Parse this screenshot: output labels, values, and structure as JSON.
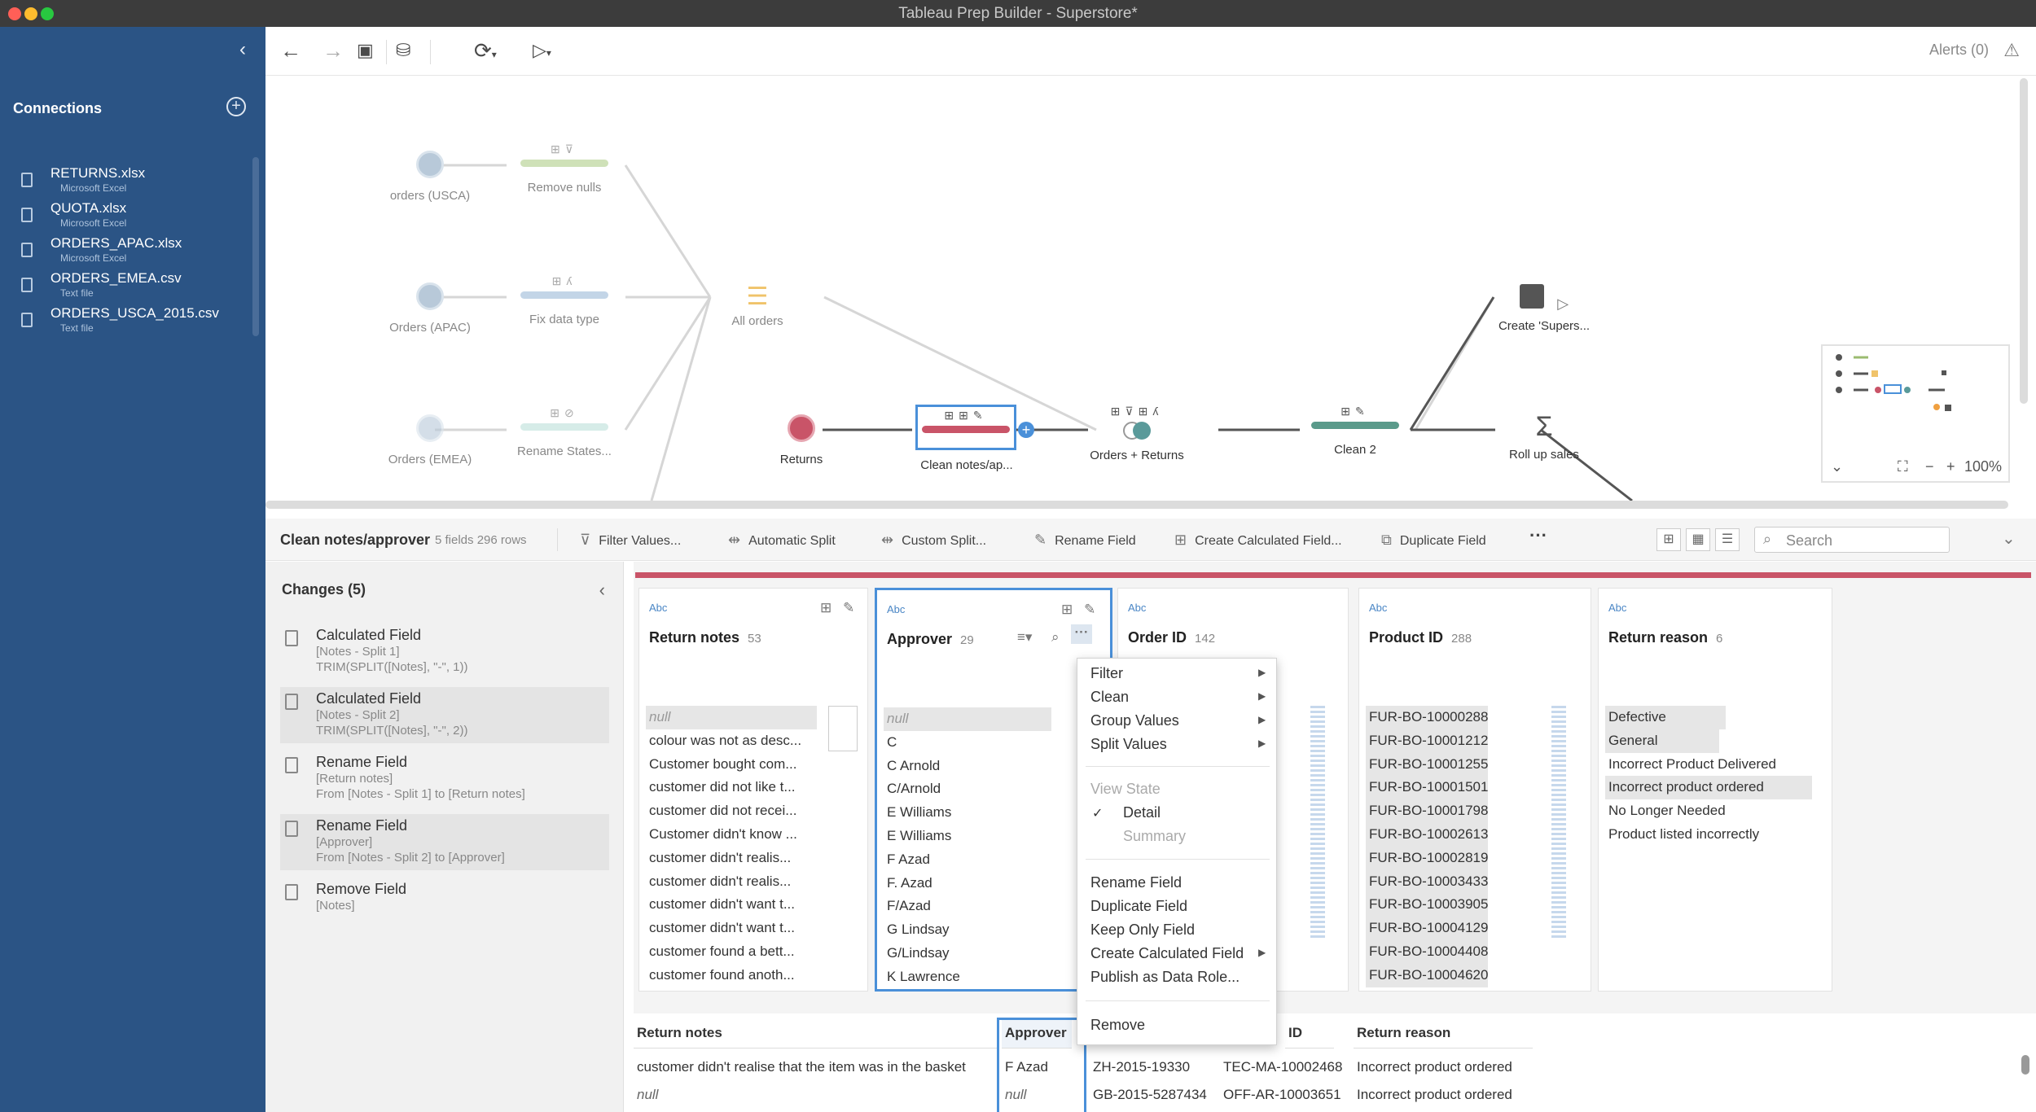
{
  "window": {
    "title": "Tableau Prep Builder - Superstore*"
  },
  "sidebar": {
    "connections_title": "Connections",
    "items": [
      {
        "name": "RETURNS.xlsx",
        "type": "Microsoft Excel"
      },
      {
        "name": "QUOTA.xlsx",
        "type": "Microsoft Excel"
      },
      {
        "name": "ORDERS_APAC.xlsx",
        "type": "Microsoft Excel"
      },
      {
        "name": "ORDERS_EMEA.csv",
        "type": "Text file"
      },
      {
        "name": "ORDERS_USCA_2015.csv",
        "type": "Text file"
      }
    ]
  },
  "toolbar": {
    "alerts": "Alerts (0)"
  },
  "flow": {
    "nodes": [
      {
        "label": "orders (USCA)"
      },
      {
        "label": "Remove nulls"
      },
      {
        "label": "Orders (APAC)"
      },
      {
        "label": "Fix data type"
      },
      {
        "label": "Orders (EMEA)"
      },
      {
        "label": "Rename States..."
      },
      {
        "label": "All orders"
      },
      {
        "label": "Returns"
      },
      {
        "label": "Clean notes/ap..."
      },
      {
        "label": "Orders + Returns"
      },
      {
        "label": "Clean 2"
      },
      {
        "label": "Create 'Supers..."
      },
      {
        "label": "Roll up sales"
      }
    ],
    "zoom": "100%"
  },
  "step": {
    "name": "Clean notes/approver",
    "meta": "5 fields  296 rows",
    "actions": [
      "Filter Values...",
      "Automatic Split",
      "Custom Split...",
      "Rename Field",
      "Create Calculated Field...",
      "Duplicate Field"
    ],
    "more": "···",
    "search_placeholder": "Search"
  },
  "changes": {
    "title": "Changes (5)",
    "items": [
      {
        "type": "Calculated Field",
        "l1": "[Notes - Split 1]",
        "l2": "TRIM(SPLIT([Notes], \"-\", 1))"
      },
      {
        "type": "Calculated Field",
        "l1": "[Notes - Split 2]",
        "l2": "TRIM(SPLIT([Notes], \"-\", 2))"
      },
      {
        "type": "Rename Field",
        "l1": "[Return notes]",
        "l2": "From [Notes - Split 1] to [Return notes]"
      },
      {
        "type": "Rename Field",
        "l1": "[Approver]",
        "l2": "From [Notes - Split 2] to [Approver]"
      },
      {
        "type": "Remove Field",
        "l1": "[Notes]",
        "l2": ""
      }
    ]
  },
  "profile": {
    "abc": "Abc",
    "cards": [
      {
        "name": "Return notes",
        "count": "53",
        "values": [
          "null",
          "colour was not as desc...",
          "Customer bought com...",
          "customer did not like t...",
          "customer did not recei...",
          "Customer didn't know ...",
          "customer didn't realis...",
          "customer didn't realis...",
          "customer didn't want t...",
          "customer didn't want t...",
          "customer found a bett...",
          "customer found anoth..."
        ]
      },
      {
        "name": "Approver",
        "count": "29",
        "values": [
          "null",
          "C",
          "C Arnold",
          "C/Arnold",
          "E  Williams",
          "E Williams",
          "F Azad",
          "F. Azad",
          "F/Azad",
          "G Lindsay",
          "G/Lindsay",
          "K Lawrence"
        ]
      },
      {
        "name": "Order ID",
        "count": "142",
        "values": []
      },
      {
        "name": "Product ID",
        "count": "288",
        "values": [
          "FUR-BO-10000288",
          "FUR-BO-10001212",
          "FUR-BO-10001255",
          "FUR-BO-10001501",
          "FUR-BO-10001798",
          "FUR-BO-10002613",
          "FUR-BO-10002819",
          "FUR-BO-10003433",
          "FUR-BO-10003905",
          "FUR-BO-10004129",
          "FUR-BO-10004408",
          "FUR-BO-10004620"
        ]
      },
      {
        "name": "Return reason",
        "count": "6",
        "values": [
          "Defective",
          "General",
          "Incorrect Product Delivered",
          "Incorrect product ordered",
          "No Longer Needed",
          "Product listed incorrectly"
        ]
      }
    ]
  },
  "context_menu": {
    "filter": "Filter",
    "clean": "Clean",
    "group": "Group Values",
    "split": "Split Values",
    "view_state": "View State",
    "detail": "Detail",
    "summary": "Summary",
    "rename": "Rename Field",
    "duplicate": "Duplicate Field",
    "keep_only": "Keep Only Field",
    "create_calc": "Create Calculated Field",
    "publish": "Publish as Data Role...",
    "remove": "Remove"
  },
  "grid": {
    "headers": [
      "Return notes",
      "Approver",
      "Order ID",
      "ID",
      "Return reason"
    ],
    "rows": [
      [
        "customer didn't realise that the item was in the basket",
        "F Azad",
        "ZH-2015-19330",
        "TEC-MA-10002468",
        "Incorrect product ordered"
      ],
      [
        "null",
        "null",
        "GB-2015-5287434",
        "OFF-AR-10003651",
        "Incorrect product ordered"
      ]
    ]
  },
  "colors": {
    "sidebar": "#2b5485",
    "accent_red": "#c95468",
    "selection_blue": "#4a90d9"
  }
}
